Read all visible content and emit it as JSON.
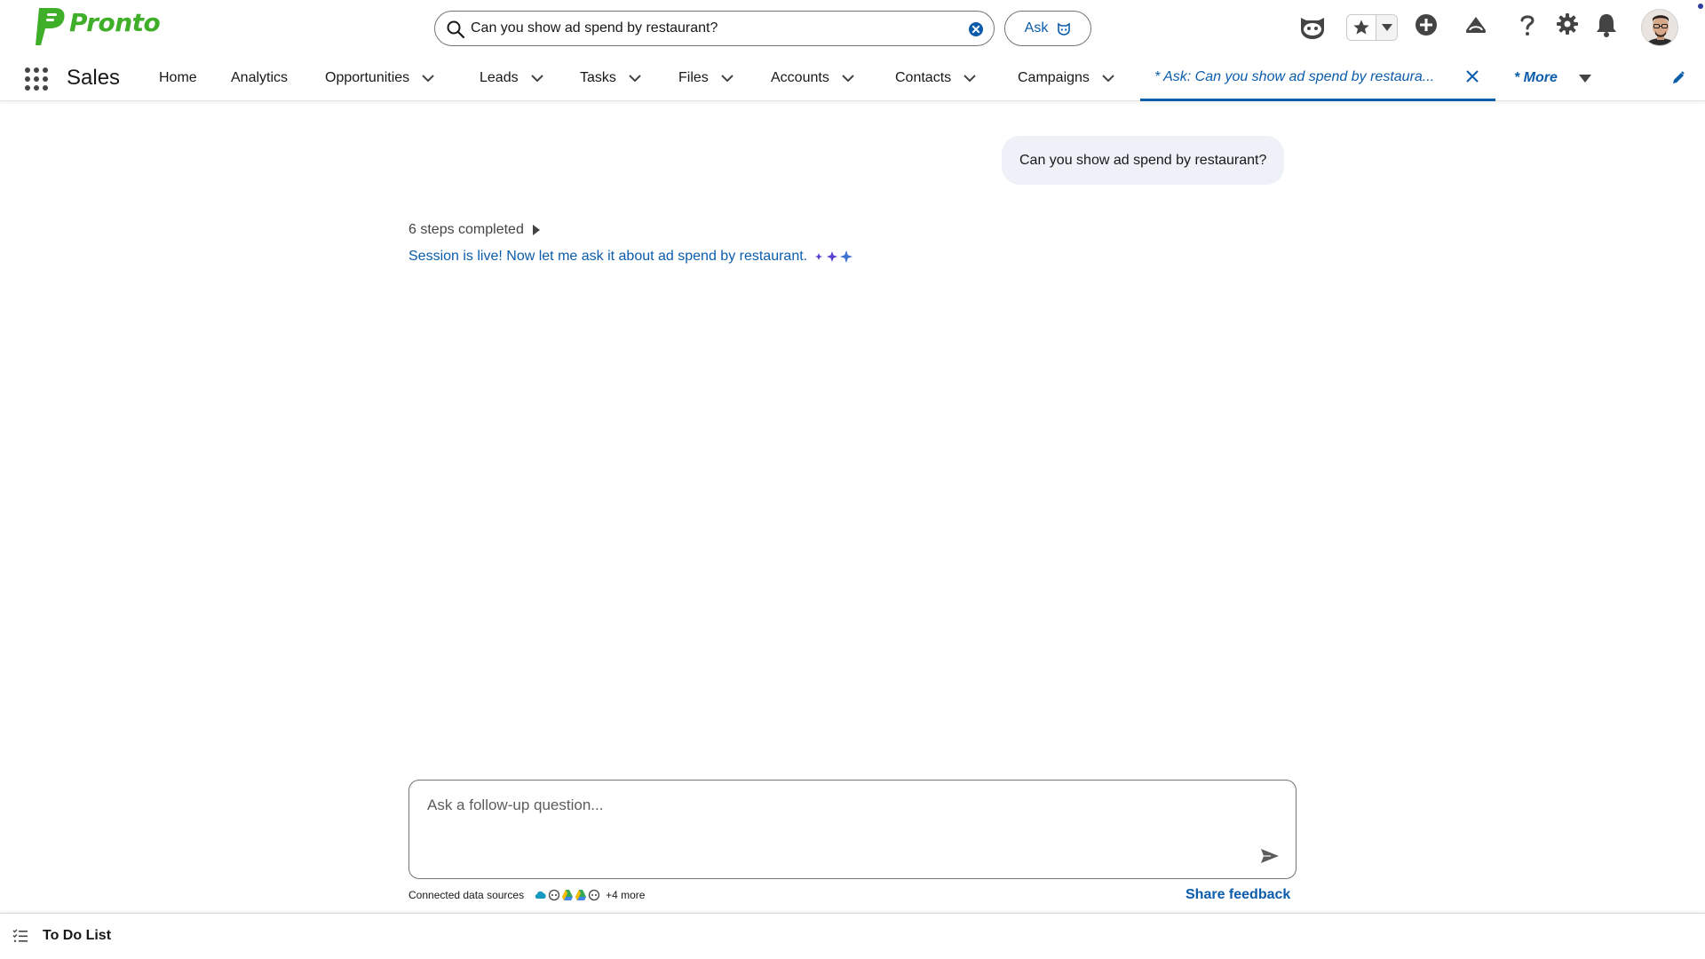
{
  "brand": {
    "name": "Pronto",
    "color": "#3fae29"
  },
  "search": {
    "value": "Can you show ad spend by restaurant?",
    "ask_label": "Ask"
  },
  "nav": {
    "app_name": "Sales",
    "items": [
      {
        "label": "Home",
        "has_menu": false
      },
      {
        "label": "Analytics",
        "has_menu": false
      },
      {
        "label": "Opportunities",
        "has_menu": true
      },
      {
        "label": "Leads",
        "has_menu": true
      },
      {
        "label": "Tasks",
        "has_menu": true
      },
      {
        "label": "Files",
        "has_menu": true
      },
      {
        "label": "Accounts",
        "has_menu": true
      },
      {
        "label": "Contacts",
        "has_menu": true
      },
      {
        "label": "Campaigns",
        "has_menu": true
      }
    ],
    "active_tab": "* Ask: Can you show ad spend by restaura...",
    "more_label": "* More"
  },
  "conversation": {
    "user_message": "Can you show ad spend by restaurant?",
    "steps_label": "6 steps completed",
    "status_text": "Session is live! Now let me ask it about ad spend by restaurant."
  },
  "composer": {
    "placeholder": "Ask a follow-up question...",
    "sources_label": "Connected data sources",
    "sources_more": "+4 more",
    "feedback_label": "Share feedback"
  },
  "utility": {
    "todo_label": "To Do List"
  },
  "colors": {
    "accent": "#0b5cab",
    "bubble": "#eef1f8",
    "text": "#181818",
    "sparkle": "#5a3fd1"
  }
}
